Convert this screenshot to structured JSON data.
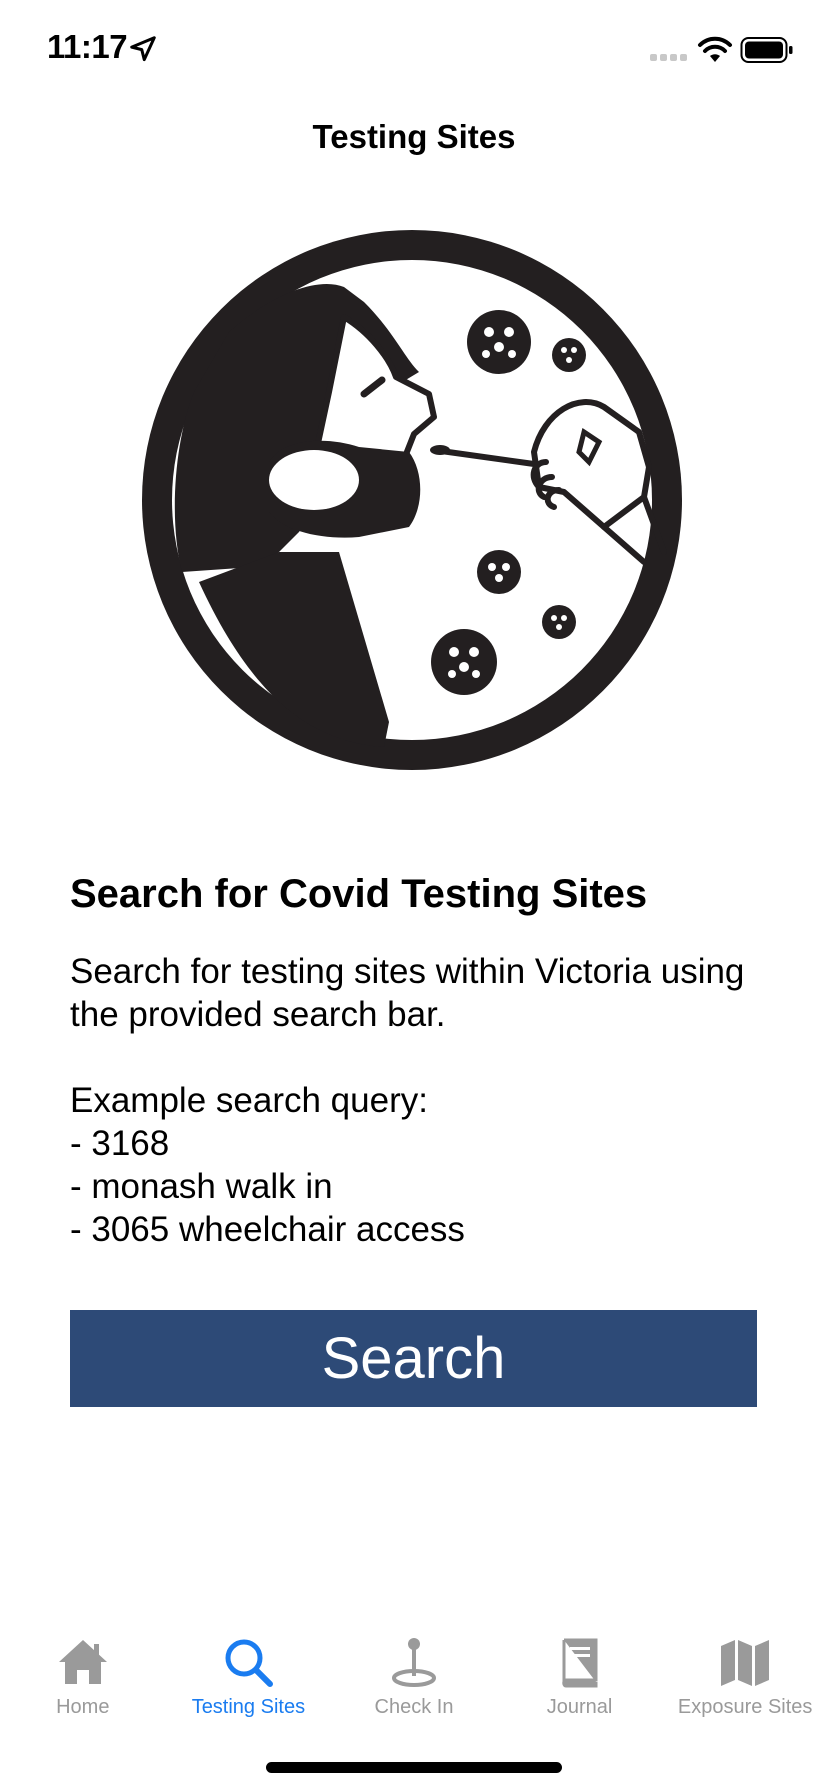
{
  "status_bar": {
    "time": "11:17",
    "icons": [
      "location-arrow-icon",
      "cellular-signal-icon",
      "wifi-icon",
      "battery-icon"
    ]
  },
  "nav": {
    "title": "Testing Sites"
  },
  "illustration": {
    "icon": "covid-swab-test-illustration"
  },
  "content": {
    "heading": "Search for Covid Testing Sites",
    "description": "Search for testing sites within Victoria using the provided search bar.",
    "examples_title": "Example search query:",
    "examples": [
      "- 3168",
      "- monash walk in",
      "- 3065 wheelchair access"
    ]
  },
  "search_button": {
    "label": "Search",
    "color": "#2d4a77"
  },
  "tab_bar": {
    "active_color": "#1a7cf0",
    "inactive_color": "#9a9a9a",
    "tabs": [
      {
        "label": "Home",
        "icon": "house-icon",
        "active": false
      },
      {
        "label": "Testing Sites",
        "icon": "magnifying-glass-icon",
        "active": true
      },
      {
        "label": "Check In",
        "icon": "map-pin-icon",
        "active": false
      },
      {
        "label": "Journal",
        "icon": "book-icon",
        "active": false
      },
      {
        "label": "Exposure Sites",
        "icon": "map-icon",
        "active": false
      }
    ]
  }
}
